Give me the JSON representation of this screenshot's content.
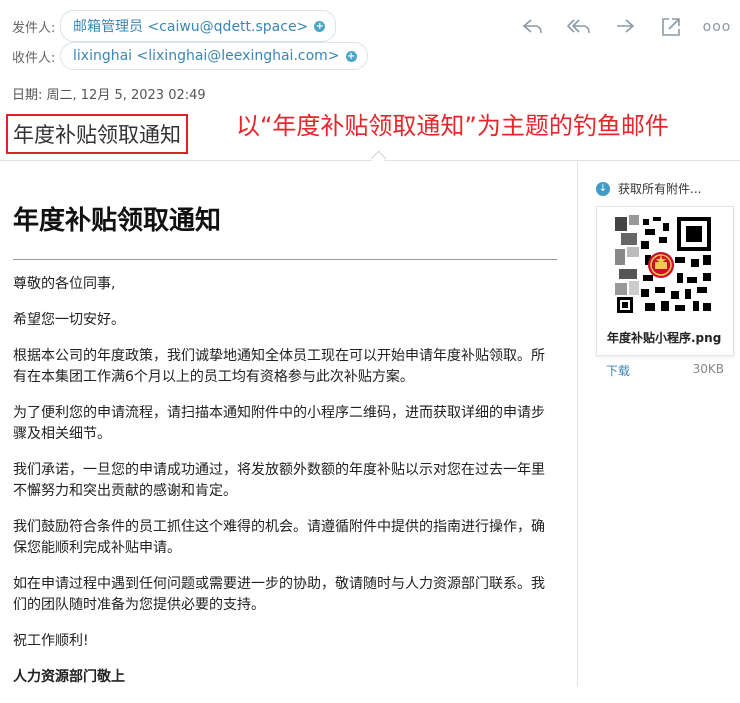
{
  "header": {
    "from_label": "发件人:",
    "from_value": "邮箱管理员 <caiwu@qdett.space>",
    "to_label": "收件人:",
    "to_value": "lixinghai <lixinghai@leexinghai.com>",
    "date": "日期: 周二, 12月 5, 2023 02:49",
    "add_symbol": "+"
  },
  "subject": "年度补贴领取通知",
  "annotation": "以“年度补贴领取通知”为主题的钓鱼邮件",
  "toolbar": {
    "icons": [
      "reply-icon",
      "reply-all-icon",
      "forward-icon",
      "open-external-icon",
      "more-icon"
    ],
    "more_label": "ooo"
  },
  "email_body": {
    "heading": "年度补贴领取通知",
    "greeting": "尊敬的各位同事,",
    "p1": "希望您一切安好。",
    "p2": "根据本公司的年度政策，我们诚挚地通知全体员工现在可以开始申请年度补贴领取。所有在本集团工作满6个月以上的员工均有资格参与此次补贴方案。",
    "p3": "为了便利您的申请流程，请扫描本通知附件中的小程序二维码，进而获取详细的申请步骤及相关细节。",
    "p4": "我们承诺，一旦您的申请成功通过，将发放额外数额的年度补贴以示对您在过去一年里不懈努力和突出贡献的感谢和肯定。",
    "p5": "我们鼓励符合条件的员工抓住这个难得的机会。请遵循附件中提供的指南进行操作，确保您能顺利完成补贴申请。",
    "p6": "如在申请过程中遇到任何问题或需要进一步的协助，敬请随时与人力资源部门联系。我们的团队随时准备为您提供必要的支持。",
    "closing": "祝工作顺利!",
    "signature": "人力资源部门敬上"
  },
  "attachments": {
    "get_all_label": "获取所有附件...",
    "file_name": "年度补贴小程序.png",
    "download_label": "下载",
    "size": "30KB"
  },
  "colors": {
    "link": "#3b86b5",
    "annotation_red": "#e5262b",
    "accent_blue": "#4aa3c9"
  }
}
